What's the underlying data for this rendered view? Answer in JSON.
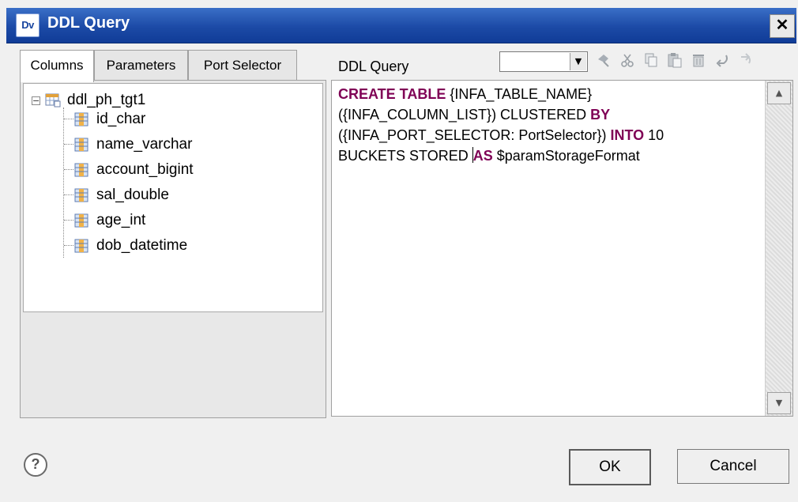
{
  "window": {
    "title": "DDL Query",
    "app_icon_text": "Dv",
    "close_glyph": "✕"
  },
  "left_panel": {
    "tabs": [
      {
        "label": "Columns",
        "active": true
      },
      {
        "label": "Parameters",
        "active": false
      },
      {
        "label": "Port Selector",
        "active": false
      }
    ],
    "tree": {
      "root": {
        "label": "ddl_ph_tgt1",
        "icon": "table-icon",
        "expanded": true,
        "toggle": "−"
      },
      "columns": [
        {
          "label": "id_char",
          "icon": "column-icon"
        },
        {
          "label": "name_varchar",
          "icon": "column-icon"
        },
        {
          "label": "account_bigint",
          "icon": "column-icon"
        },
        {
          "label": "sal_double",
          "icon": "column-icon"
        },
        {
          "label": "age_int",
          "icon": "column-icon"
        },
        {
          "label": "dob_datetime",
          "icon": "column-icon"
        }
      ]
    }
  },
  "editor": {
    "label": "DDL Query",
    "dropdown_value": "",
    "toolbar_icons": [
      "pin-icon",
      "cut-icon",
      "copy-icon",
      "paste-icon",
      "delete-icon",
      "undo-icon",
      "redo-icon"
    ],
    "code_tokens": [
      {
        "t": "CREATE TABLE",
        "kw": true
      },
      {
        "t": " {INFA_TABLE_NAME}\n({INFA_COLUMN_LIST}) CLUSTERED ",
        "kw": false
      },
      {
        "t": "BY",
        "kw": true
      },
      {
        "t": "\n({INFA_PORT_SELECTOR: PortSelector}) ",
        "kw": false
      },
      {
        "t": "INTO",
        "kw": true
      },
      {
        "t": " 10\nBUCKETS STORED ",
        "kw": false
      },
      {
        "t": "AS",
        "kw": true,
        "caret_before": true
      },
      {
        "t": " $paramStorageFormat",
        "kw": false
      }
    ]
  },
  "footer": {
    "help_glyph": "?",
    "ok_label": "OK",
    "cancel_label": "Cancel"
  }
}
